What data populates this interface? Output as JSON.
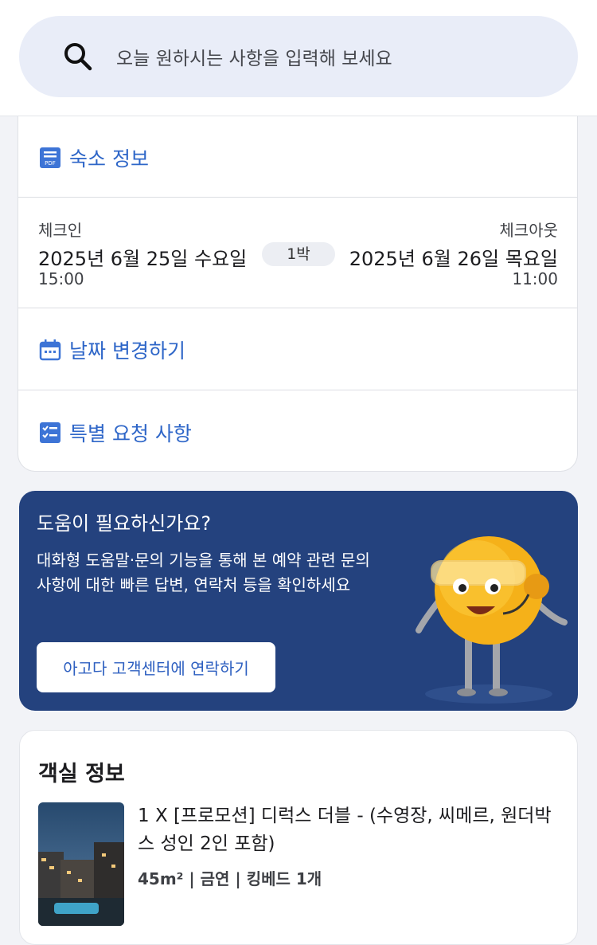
{
  "search": {
    "placeholder": "오늘 원하시는 사항을 입력해 보세요"
  },
  "booking": {
    "property_info_label": "숙소 정보",
    "checkin": {
      "label": "체크인",
      "date": "2025년 6월 25일 수요일",
      "time": "15:00"
    },
    "checkout": {
      "label": "체크아웃",
      "date": "2025년 6월 26일 목요일",
      "time": "11:00"
    },
    "nights": "1박",
    "change_dates_label": "날짜 변경하기",
    "special_requests_label": "특별 요청 사항"
  },
  "help": {
    "title": "도움이 필요하신가요?",
    "description": "대화형 도움말·문의 기능을 통해 본 예약 관련 문의 사항에 대한 빠른 답변, 연락처 등을 확인하세요",
    "button_label": "아고다 고객센터에 연락하기"
  },
  "room": {
    "section_title": "객실 정보",
    "name": "1 X [프로모션] 디럭스 더블 - (수영장, 씨메르, 원더박스 성인 2인 포함)",
    "meta": "45m² | 금연 | 킹베드 1개"
  },
  "colors": {
    "accent": "#2e66c8",
    "help_bg": "#24427e",
    "search_bg": "#e9edf8"
  }
}
